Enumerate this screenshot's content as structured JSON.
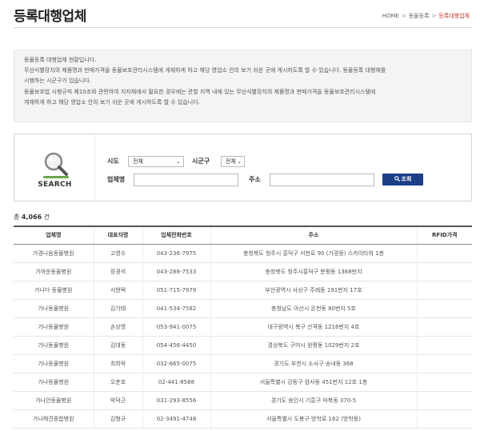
{
  "header": {
    "title": "등록대행업체",
    "breadcrumb": [
      "HOME",
      "동물등록",
      "등록대행업체"
    ],
    "separator": ">"
  },
  "notice": {
    "lines": [
      "동물등록 대행업체 현황입니다.",
      "무선식별장치의 제품명과 판매가격을 동물보호관리시스템에 게재하게 하고 해당 영업소 안의 보기 쉬운 곳에 게시하도록 할 수 있습니다. 동물등록 대행체를",
      "시행하는 시군구가 있습니다.",
      "동물보호법 시행규칙 제10조와 관련하여 지자체에서 필요한 경우에는 관할 지역 내에 있는 무선식별장치의 제품명과 판매가격을 동물보호관리시스템에",
      "게재하게 하고 해당 영업소 안의 보기 쉬운 곳에 게시하도록 할 수 있습니다."
    ]
  },
  "search": {
    "caption": "SEARCH",
    "sido_label": "시도",
    "sido_value": "전체",
    "sigungu_label": "시군구",
    "sigungu_value": "전체",
    "company_label": "업체명",
    "address_label": "주소",
    "button_label": "조회",
    "company_value": "",
    "address_value": ""
  },
  "result": {
    "total_prefix": "총",
    "total_count": "4,066",
    "total_suffix": "건"
  },
  "table": {
    "columns": [
      "업체명",
      "대표자명",
      "업체전화번호",
      "주소",
      "RFID가격"
    ],
    "rows": [
      [
        "가경나음동물병원",
        "고영수",
        "043-236-7975",
        "충청북도 청주시 흥덕구 서현로 90 (가경동) 스카이타워 1층",
        ""
      ],
      [
        "가까운동물병원",
        "장경석",
        "043-288-7533",
        "충청북도 청주시흥덕구 분평동 1368번지",
        ""
      ],
      [
        "가나다 동물병원",
        "서현택",
        "051-715-7979",
        "부산광역시 사상구 주례동 191번지 17호",
        ""
      ],
      [
        "가나동물병원",
        "김기태",
        "041-534-7582",
        "충청남도 아산시 온천동 80번지 5호",
        ""
      ],
      [
        "가나동물병원",
        "손상영",
        "053-941-0075",
        "대구광역시 북구 산격동 1216번지 4호",
        ""
      ],
      [
        "가나동물병원",
        "김대동",
        "054-456-4450",
        "경상북도 구미시 원평동 1029번지 2호",
        ""
      ],
      [
        "가나동물병원",
        "최희락",
        "032-665-0075",
        "경기도 부천시 소사구 송내동 368",
        ""
      ],
      [
        "가나동물병원",
        "오춘호",
        "02-441-8588",
        "서울특별시 강동구 암사동 451번지 12호 1층",
        ""
      ],
      [
        "가나안동물병원",
        "박덕근",
        "031-293-8556",
        "경기도 용인시 기흥구 마북동 370-5",
        ""
      ],
      [
        "가나해견종합병원",
        "김형규",
        "02-3491-4748",
        "서울특별시 도봉구 방학로 162 (방학동)",
        ""
      ]
    ]
  },
  "colors": {
    "button_bg": "#1c3f86",
    "notice_bg": "#f4f4f4",
    "breadcrumb_current": "#c0392b"
  },
  "icons": {
    "search_logo": "magnifier-icon",
    "button_icon": "search-icon"
  }
}
